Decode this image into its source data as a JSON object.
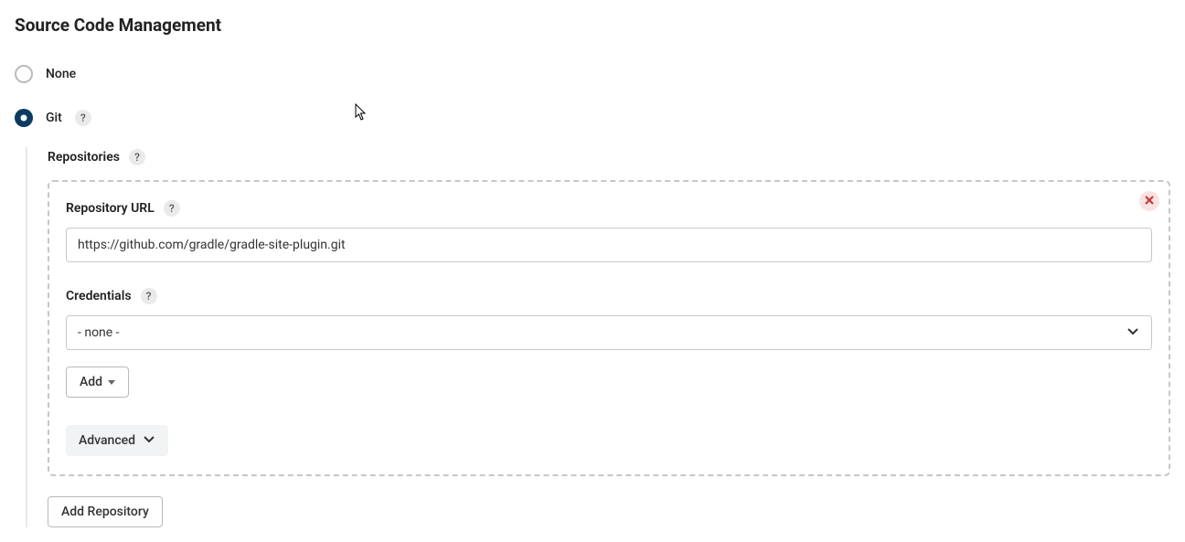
{
  "section_title": "Source Code Management",
  "scm": {
    "options": {
      "none": {
        "label": "None",
        "selected": false
      },
      "git": {
        "label": "Git",
        "selected": true
      }
    }
  },
  "git": {
    "repositories_label": "Repositories",
    "repo": {
      "url_label": "Repository URL",
      "url_value": "https://github.com/gradle/gradle-site-plugin.git",
      "credentials_label": "Credentials",
      "credentials_selected": "- none -",
      "add_button": "Add",
      "advanced_button": "Advanced"
    },
    "add_repository_button": "Add Repository"
  },
  "help_tooltip_glyph": "?"
}
